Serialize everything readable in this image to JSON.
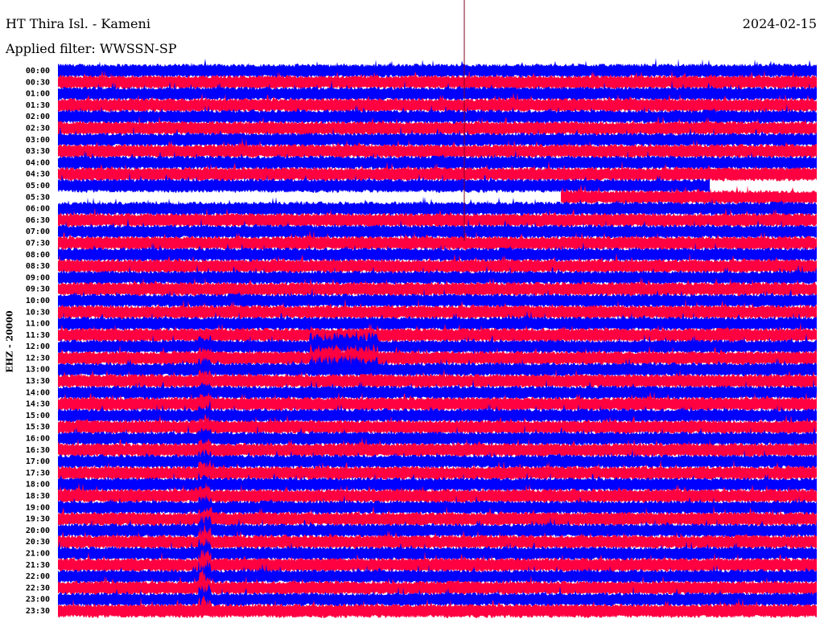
{
  "header": {
    "station": "HT Thira Isl. - Kameni",
    "filter": "Applied filter: WWSSN-SP",
    "date": "2024-02-15"
  },
  "chart_data": {
    "type": "line",
    "title": "HT Thira Isl. - Kameni",
    "ylabel": "EHZ - 20000",
    "row_labels": [
      "00:00",
      "00:30",
      "01:00",
      "01:30",
      "02:00",
      "02:30",
      "03:00",
      "03:30",
      "04:00",
      "04:30",
      "05:00",
      "05:30",
      "06:00",
      "06:30",
      "07:00",
      "07:30",
      "08:00",
      "08:30",
      "09:00",
      "09:30",
      "10:00",
      "10:30",
      "11:00",
      "11:30",
      "12:00",
      "12:30",
      "13:00",
      "13:30",
      "14:00",
      "14:30",
      "15:00",
      "15:30",
      "16:00",
      "16:30",
      "17:00",
      "17:30",
      "18:00",
      "18:30",
      "19:00",
      "19:30",
      "20:00",
      "20:30",
      "21:00",
      "21:30",
      "22:00",
      "22:30",
      "23:00",
      "23:30"
    ],
    "row_minutes": 30,
    "series_colors": [
      "#0000ff",
      "#ff0040"
    ],
    "marker_color": "#800020"
  }
}
